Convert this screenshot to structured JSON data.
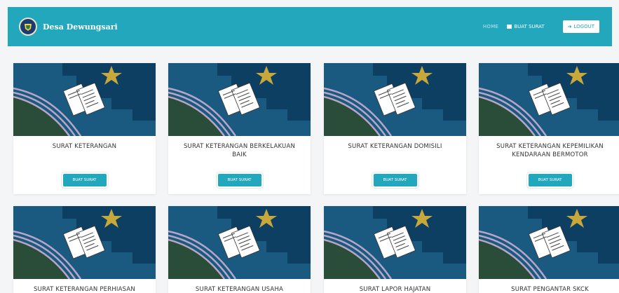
{
  "brand": {
    "name": "Desa Dewungsari"
  },
  "nav": {
    "home": "HOME",
    "buat_surat": "BUAT SURAT",
    "logout": "LOGOUT"
  },
  "cards": [
    {
      "title": "SURAT KETERANGAN",
      "button": "BUAT SURAT"
    },
    {
      "title": "SURAT KETERANGAN BERKELAKUAN BAIK",
      "button": "BUAT SURAT"
    },
    {
      "title": "SURAT KETERANGAN DOMISILI",
      "button": "BUAT SURAT"
    },
    {
      "title": "SURAT KETERANGAN KEPEMILIKAN KENDARAAN BERMOTOR",
      "button": "BUAT SURAT"
    },
    {
      "title": "SURAT KETERANGAN PERHIASAN"
    },
    {
      "title": "SURAT KETERANGAN USAHA"
    },
    {
      "title": "SURAT LAPOR HAJATAN"
    },
    {
      "title": "SURAT PENGANTAR SKCK"
    }
  ],
  "colors": {
    "accent": "#22a7bd",
    "illustration_bg": "#0d3f63",
    "star": "#c9a83b"
  },
  "icons": {
    "logout": "sign-out-icon",
    "buat_surat": "envelope-icon"
  }
}
